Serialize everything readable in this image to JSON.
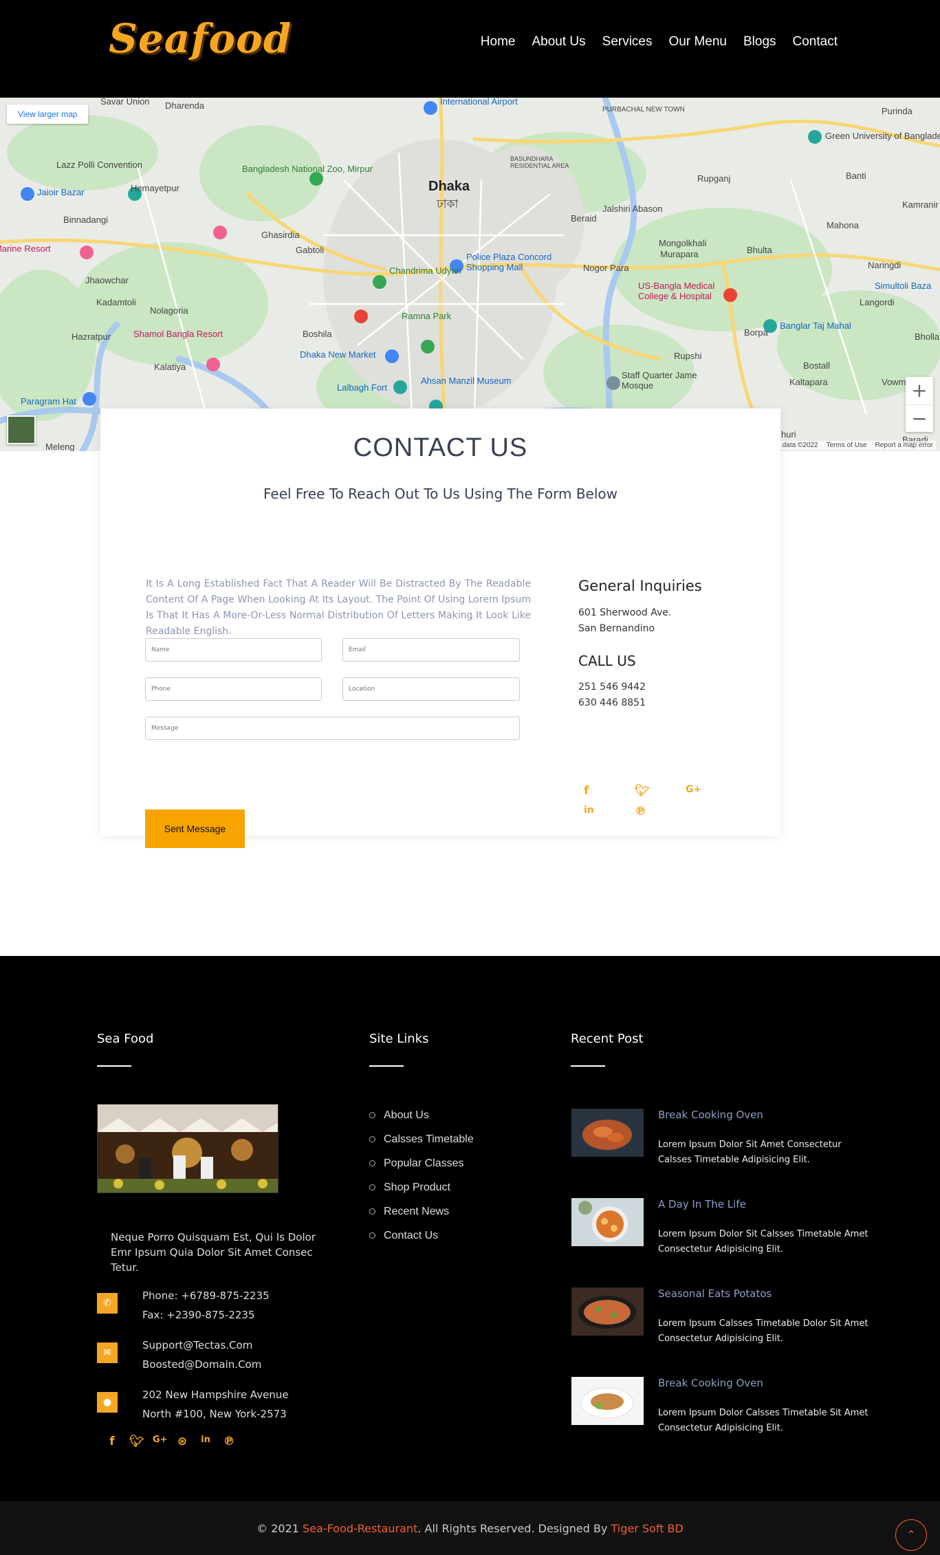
{
  "header": {
    "logo": "Seafood",
    "nav": [
      "Home",
      "About Us",
      "Services",
      "Our Menu",
      "Blogs",
      "Contact"
    ]
  },
  "map": {
    "larger_map_link": "View larger map",
    "labels": {
      "savar": "Savar Union",
      "dharenda": "Dharenda",
      "airport": "International Airport",
      "purbachal": "PURBACHAL NEW TOWN",
      "purinda": "Purinda",
      "green_univ": "Green University of Bangladesh",
      "lazz": "Lazz Polli Convention",
      "national_zoo": "Bangladesh National Zoo, Mirpur",
      "dhaka": "Dhaka",
      "dhaka_bn": "ঢাকা",
      "basundhara": "BASUNDHARA RESIDENTIAL AREA",
      "rupganj": "Rupganj",
      "banti": "Banti",
      "jaioir": "Jaioir Bazar",
      "hemayetpur": "Hemayetpur",
      "jalshiri": "Jalshiri Abason",
      "beraid": "Beraid",
      "mahona": "Mahona",
      "kamranir": "Kamranir",
      "binnadangi": "Binnadangi",
      "marine_resort": "Marine Resort",
      "ghasirdia": "Ghasirdia",
      "gabtoli": "Gabtoli",
      "chandrima": "Chandrima Udyan",
      "police_plaza": "Police Plaza Concord Shopping Mall",
      "mongolkhali": "Mongolkhali",
      "murapara": "Murapara",
      "bhulta": "Bhulta",
      "naringdi": "Naringdi",
      "jhaowchar": "Jhaowchar",
      "nogor_para": "Nogor Para",
      "us_bangla": "US-Bangla Medical College & Hospital",
      "simultoli": "Simultoli Baza",
      "kadamtoli": "Kadamtoli",
      "nolagoria": "Nolagoria",
      "ramna": "Ramna Park",
      "langordi": "Langordi",
      "hazratpur": "Hazratpur",
      "boshila": "Boshila",
      "borpa": "Borpa",
      "banglar_taj": "Banglar Taj Mahal",
      "bholla": "Bholla",
      "shamol": "Shamol Bangla Resort",
      "kalatiya": "Kalatiya",
      "dhaka_new_market": "Dhaka New Market",
      "rupshi": "Rupshi",
      "bostall": "Bostall",
      "ahsan": "Ahsan Manzil Museum",
      "staff_quarter": "Staff Quarter Jame Mosque",
      "kaltapara": "Kaltapara",
      "vowm": "Vowm",
      "paragram": "Paragram Hat",
      "lalbagh": "Lalbagh Fort",
      "meleng": "Meleng",
      "huri": "huri",
      "baradi": "Baradi"
    },
    "attribution": [
      "data ©2022",
      "Terms of Use",
      "Report a map error"
    ],
    "zoom_in": "+",
    "zoom_out": "−"
  },
  "contact": {
    "title": "CONTACT US",
    "subtitle": "Feel Free To Reach Out To Us Using The Form Below",
    "description": "It Is A Long Established Fact That A Reader Will Be Distracted By The Readable Content Of A Page When Looking At Its Layout. The Point Of Using Lorem Ipsum Is That It Has A More-Or-Less Normal Distribution Of Letters Making It Look Like Readable English.",
    "placeholders": {
      "name": "Name",
      "email": "Email",
      "phone": "Phone",
      "location": "Location",
      "message": "Message"
    },
    "submit_label": "Sent Message",
    "inquiries_title": "General Inquiries",
    "address_line1": "601 Sherwood Ave.",
    "address_line2": "San Bernandino",
    "call_title": "CALL US",
    "phone1": "251 546 9442",
    "phone2": "630 446 8851",
    "social_icons": [
      "facebook-icon",
      "twitter-icon",
      "google-plus-icon",
      "linkedin-icon",
      "pinterest-icon"
    ]
  },
  "footer": {
    "col1_title": "Sea Food",
    "col1_text": "Neque Porro Quisquam Est, Qui Is Dolor Emr Ipsum Quia Dolor Sit Amet Consec Tetur.",
    "phone_line": "Phone: +6789-875-2235",
    "fax_line": "Fax: +2390-875-2235",
    "email1": "Support@Tectas.Com",
    "email2": "Boosted@Domain.Com",
    "address1": "202 New Hampshire Avenue",
    "address2": "North #100, New York-2573",
    "social_icons": [
      "facebook-icon",
      "twitter-icon",
      "google-plus-icon",
      "dribbble-icon",
      "linkedin-icon",
      "pinterest-icon"
    ],
    "col2_title": "Site Links",
    "links": [
      "About Us",
      "Calsses Timetable",
      "Popular Classes",
      "Shop Product",
      "Recent News",
      "Contact Us"
    ],
    "col3_title": "Recent Post",
    "posts": [
      {
        "title": "Break Cooking Oven",
        "text": "Lorem Ipsum Dolor Sit Amet Consectetur Calsses Timetable Adipisicing Elit."
      },
      {
        "title": "A Day In The Life",
        "text": "Lorem Ipsum Dolor Sit Calsses Timetable Amet Consectetur Adipisicing Elit."
      },
      {
        "title": "Seasonal Eats Potatos",
        "text": "Lorem Ipsum Calsses Timetable Dolor Sit Amet Consectetur Adipisicing Elit."
      },
      {
        "title": "Break Cooking Oven",
        "text": "Lorem Ipsum Dolor Calsses Timetable Sit Amet Consectetur Adipisicing Elit."
      }
    ]
  },
  "bottom": {
    "copy_prefix": "© 2021 ",
    "site_name": "Sea-Food-Restaurant",
    "copy_middle": ". All Rights Reserved. Designed By ",
    "designer": "Tiger Soft BD",
    "to_top": "⌃"
  },
  "colors": {
    "accent": "#f6a623",
    "button": "#f7a300",
    "footer_accent": "#f0602f",
    "background": "#000000"
  }
}
